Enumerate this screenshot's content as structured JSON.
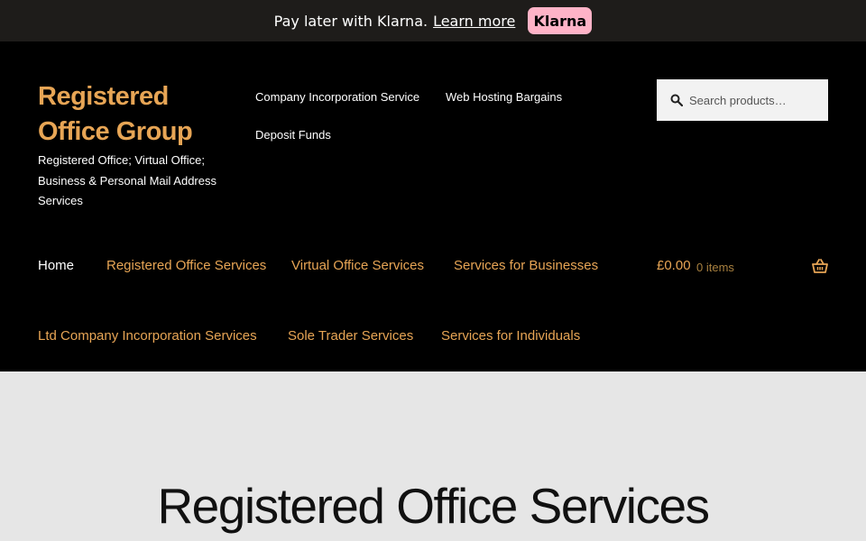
{
  "klarna": {
    "message": "Pay later with Klarna.",
    "link": "Learn more",
    "badge": "Klarna"
  },
  "site": {
    "title": "Registered Office Group",
    "description": "Registered Office; Virtual Office; Business & Personal Mail Address Services"
  },
  "secondary_nav": [
    {
      "label": "Company Incorporation Service"
    },
    {
      "label": "Web Hosting Bargains"
    },
    {
      "label": "Deposit Funds"
    }
  ],
  "search": {
    "placeholder": "Search products…"
  },
  "primary_nav": [
    {
      "label": "Home"
    },
    {
      "label": "Registered Office Services"
    },
    {
      "label": "Virtual Office Services"
    },
    {
      "label": "Services for Businesses"
    },
    {
      "label": "Ltd Company Incorporation Services"
    },
    {
      "label": "Sole Trader Services"
    },
    {
      "label": "Services for Individuals"
    }
  ],
  "cart": {
    "amount": "£0.00",
    "count": "0 items",
    "icon": "basket-icon"
  },
  "hero": {
    "title": "Registered Office Services"
  },
  "colors": {
    "accent": "#e7a555",
    "header_bg": "#000000",
    "hero_bg": "#e6e6e6",
    "klarna_pink": "#ffb3c7"
  }
}
